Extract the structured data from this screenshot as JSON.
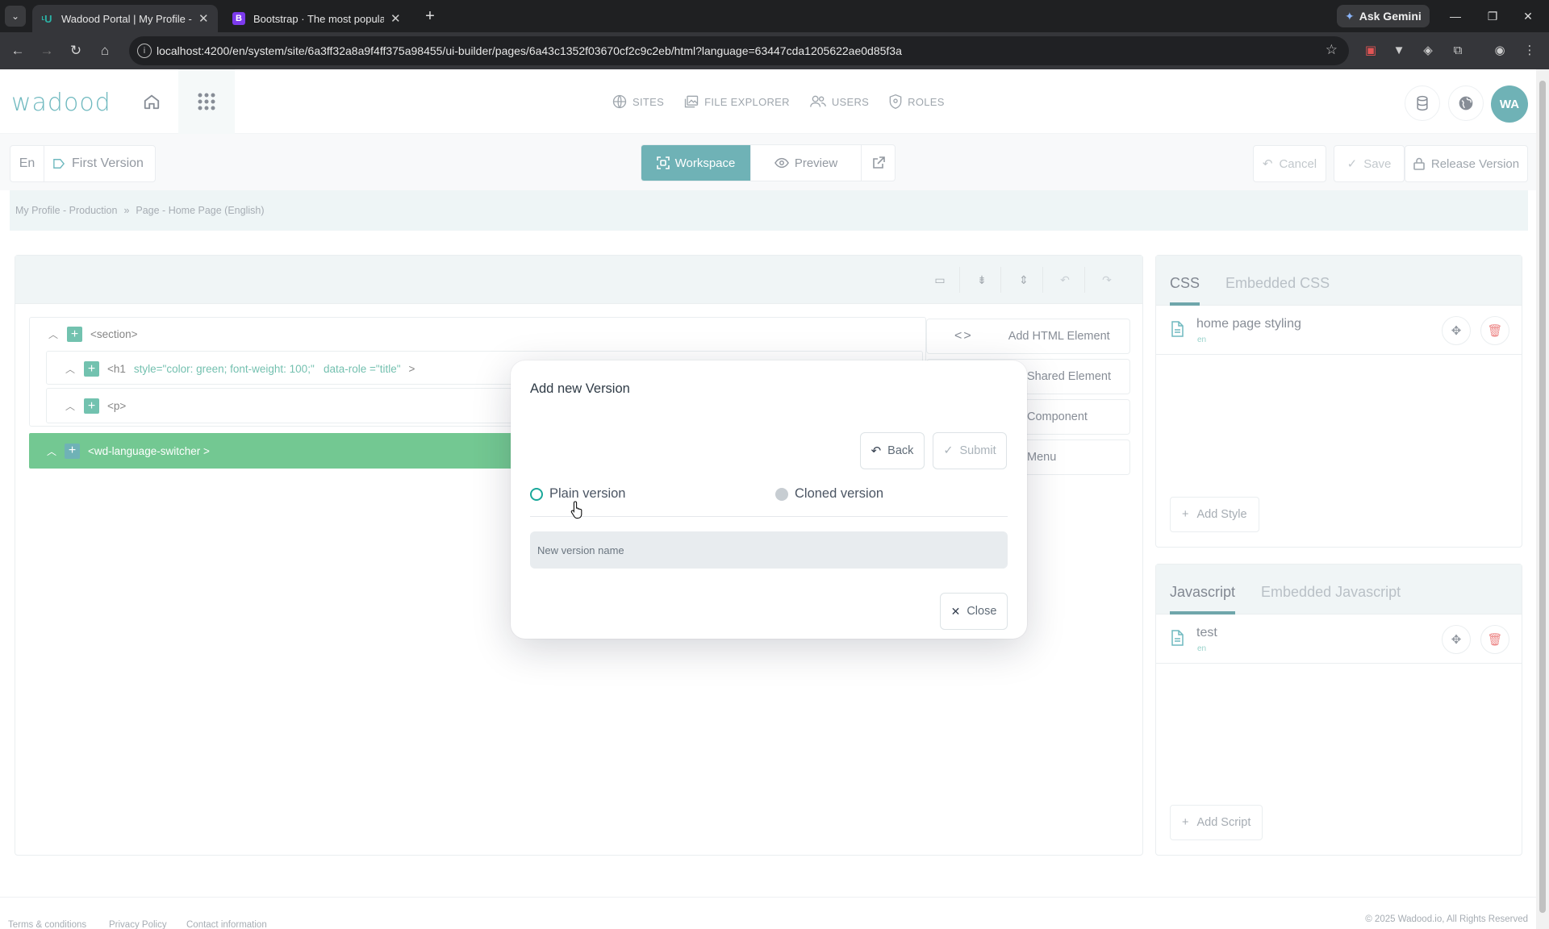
{
  "browser": {
    "tabs": [
      {
        "title": "Wadood Portal | My Profile - Ui",
        "active": true
      },
      {
        "title": "Bootstrap · The most popular H",
        "active": false
      }
    ],
    "ask_gemini": "Ask Gemini",
    "url": "localhost:4200/en/system/site/6a3ff32a8a9f4ff375a98455/ui-builder/pages/6a43c1352f03670cf2c9c2eb/html?language=63447cda1205622ae0d85f3a"
  },
  "header": {
    "logo": "wadood",
    "nav": [
      {
        "label": "SITES",
        "icon": "globe-icon"
      },
      {
        "label": "FILE EXPLORER",
        "icon": "images-icon"
      },
      {
        "label": "USERS",
        "icon": "users-icon"
      },
      {
        "label": "ROLES",
        "icon": "shield-icon"
      }
    ],
    "avatar": "WA"
  },
  "toolbar": {
    "language": "En",
    "version": "First Version",
    "workspace": "Workspace",
    "preview": "Preview",
    "cancel": "Cancel",
    "save": "Save",
    "release": "Release Version"
  },
  "breadcrumb": {
    "items": [
      "My Profile - Production",
      "Page - Home Page (English)"
    ],
    "separator": "»"
  },
  "tree": {
    "nodes": [
      {
        "tag": "<section>"
      },
      {
        "tag": "<h1",
        "attrs": "style=\"color: green; font-weight: 100;\"   data-role =\"title\"",
        "close": ">"
      },
      {
        "tag": "<p>"
      },
      {
        "tag": "<wd-language-switcher >"
      }
    ],
    "side_buttons": [
      "Add HTML Element",
      "Shared Element",
      "Component",
      "Menu"
    ]
  },
  "css_panel": {
    "tabs": [
      "CSS",
      "Embedded CSS"
    ],
    "item": {
      "name": "home page styling",
      "lang": "en"
    },
    "add": "Add Style"
  },
  "js_panel": {
    "tabs": [
      "Javascript",
      "Embedded Javascript"
    ],
    "item": {
      "name": "test",
      "lang": "en"
    },
    "add": "Add Script"
  },
  "modal": {
    "title": "Add new Version",
    "back": "Back",
    "submit": "Submit",
    "option_plain": "Plain version",
    "option_cloned": "Cloned version",
    "name_placeholder": "New version name",
    "close": "Close"
  },
  "footer": {
    "links": [
      "Terms & conditions",
      "Privacy Policy",
      "Contact information"
    ],
    "copyright": "© 2025 Wadood.io, All Rights Reserved"
  },
  "colors": {
    "accent": "#0f7f86",
    "active_node": "#16a34a",
    "plus": "#159a7b"
  }
}
